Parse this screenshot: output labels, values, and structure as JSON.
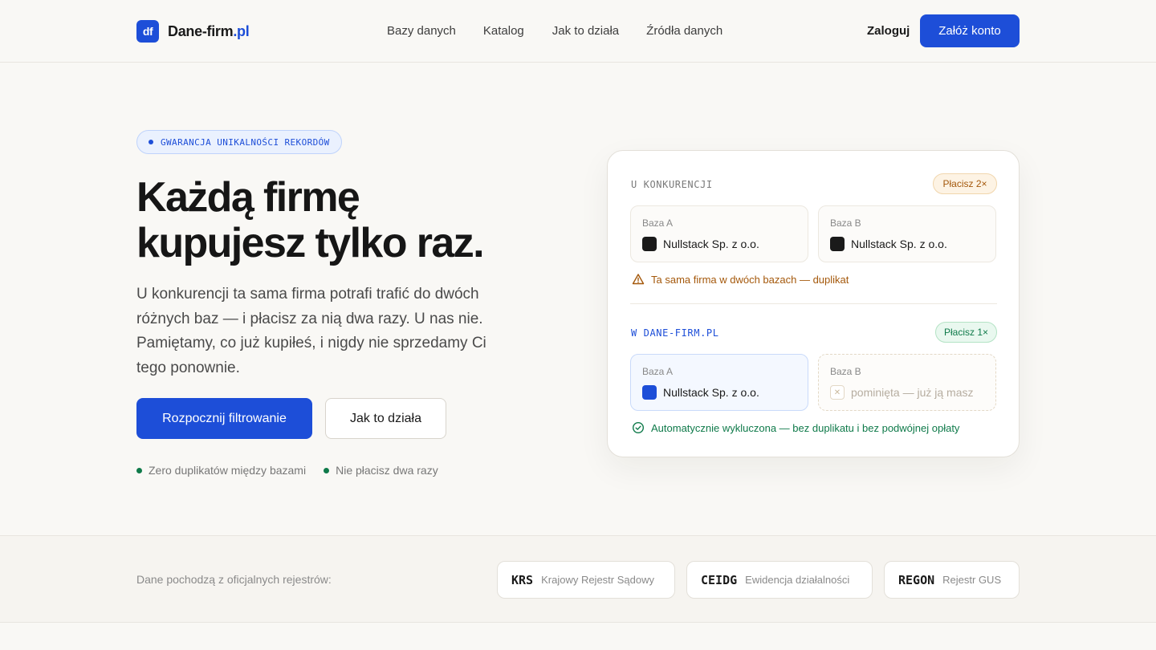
{
  "header": {
    "logo_mark": "df",
    "logo_name": "Dane-firm",
    "logo_tld": ".pl",
    "nav": [
      "Bazy danych",
      "Katalog",
      "Jak to działa",
      "Źródła danych"
    ],
    "login_label": "Zaloguj",
    "signup_label": "Załóż konto"
  },
  "hero": {
    "badge": "GWARANCJA UNIKALNOŚCI REKORDÓW",
    "title_line1": "Każdą firmę",
    "title_line2": "kupujesz tylko raz.",
    "lead": "U konkurencji ta sama firma potrafi trafić do dwóch różnych baz — i płacisz za nią dwa razy. U nas nie. Pamiętamy, co już kupiłeś, i nigdy nie sprzedamy Ci tego ponownie.",
    "primary_cta": "Rozpocznij filtrowanie",
    "secondary_cta": "Jak to działa",
    "checks": [
      "Zero duplikatów między bazami",
      "Nie płacisz dwa razy"
    ]
  },
  "comparison": {
    "competitor": {
      "label": "U KONKURENCJI",
      "pill": "Płacisz 2×",
      "tiles": [
        {
          "label": "Baza A",
          "company": "Nullstack Sp. z o.o."
        },
        {
          "label": "Baza B",
          "company": "Nullstack Sp. z o.o."
        }
      ],
      "note": "Ta sama firma w dwóch bazach — duplikat"
    },
    "ours": {
      "label": "W DANE-FIRM.PL",
      "pill": "Płacisz 1×",
      "tiles": [
        {
          "label": "Baza A",
          "company": "Nullstack Sp. z o.o."
        },
        {
          "label": "Baza B",
          "company": "pominięta — już ją masz"
        }
      ],
      "note": "Automatycznie wykluczona — bez duplikatu i bez podwójnej opłaty"
    }
  },
  "sources": {
    "label": "Dane pochodzą z oficjalnych rejestrów:",
    "items": [
      {
        "code": "KRS",
        "name": "Krajowy Rejestr Sądowy"
      },
      {
        "code": "CEIDG",
        "name": "Ewidencja działalności"
      },
      {
        "code": "REGON",
        "name": "Rejestr GUS"
      }
    ]
  },
  "colors": {
    "accent": "#1d4ed8",
    "warning": "#a4580b",
    "success": "#0f7a4a",
    "background": "#f9f8f5"
  }
}
